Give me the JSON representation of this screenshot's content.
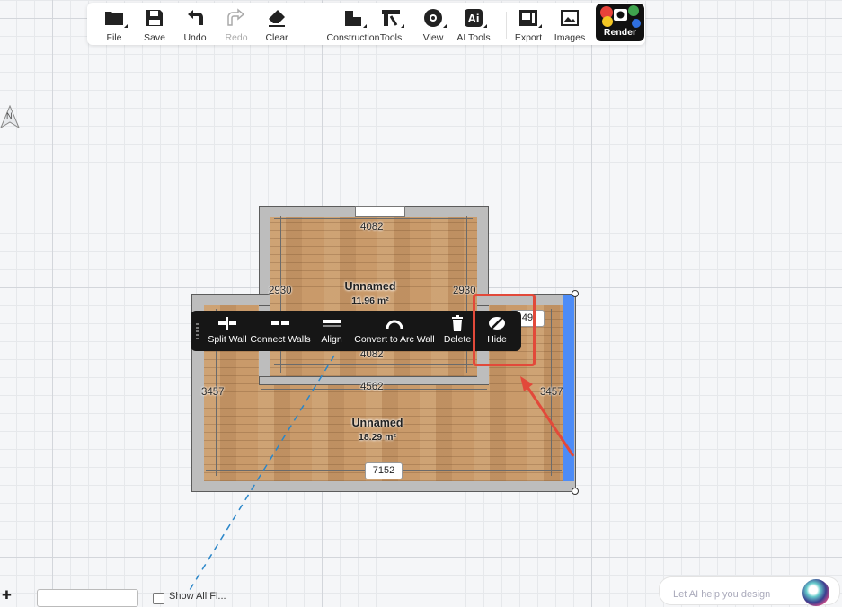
{
  "toolbar": {
    "items": [
      {
        "label": "File",
        "icon": "folder-icon"
      },
      {
        "label": "Save",
        "icon": "save-icon"
      },
      {
        "label": "Undo",
        "icon": "undo-icon"
      },
      {
        "label": "Redo",
        "icon": "redo-icon",
        "disabled": true
      },
      {
        "label": "Clear",
        "icon": "eraser-icon"
      },
      {
        "label": "Construction",
        "icon": "construction-icon"
      },
      {
        "label": "Tools",
        "icon": "tools-icon"
      },
      {
        "label": "View",
        "icon": "eye-icon"
      },
      {
        "label": "AI Tools",
        "icon": "ai-icon"
      },
      {
        "label": "Export",
        "icon": "export-icon"
      },
      {
        "label": "Images",
        "icon": "images-icon"
      }
    ],
    "render_label": "Render"
  },
  "compass": {
    "label": "N"
  },
  "plan": {
    "room_top": {
      "name": "Unnamed",
      "area": "11.96 m²"
    },
    "room_bottom": {
      "name": "Unnamed",
      "area": "18.29 m²"
    },
    "dims": {
      "top_width": "4082",
      "top_left_height": "2930",
      "top_right_height": "2930",
      "top_inner_bottom": "4082",
      "middle_width": "4562",
      "left_height": "3457",
      "right_height": "3457",
      "bottom_width": "7152",
      "partial_badge": "49"
    }
  },
  "context_menu": {
    "items": [
      {
        "label": "Split Wall",
        "icon": "split-wall-icon"
      },
      {
        "label": "Connect Walls",
        "icon": "connect-walls-icon"
      },
      {
        "label": "Align",
        "icon": "align-icon"
      },
      {
        "label": "Convert to Arc Wall",
        "icon": "arc-wall-icon"
      },
      {
        "label": "Delete",
        "icon": "trash-icon"
      },
      {
        "label": "Hide",
        "icon": "hide-icon"
      }
    ]
  },
  "bottom": {
    "checkbox_label": "Show All Fl...",
    "ai_placeholder": "Let AI help you design"
  },
  "colors": {
    "selected_wall": "#4d8cf7",
    "highlight": "#e2493a",
    "menu_bg": "#161616"
  }
}
